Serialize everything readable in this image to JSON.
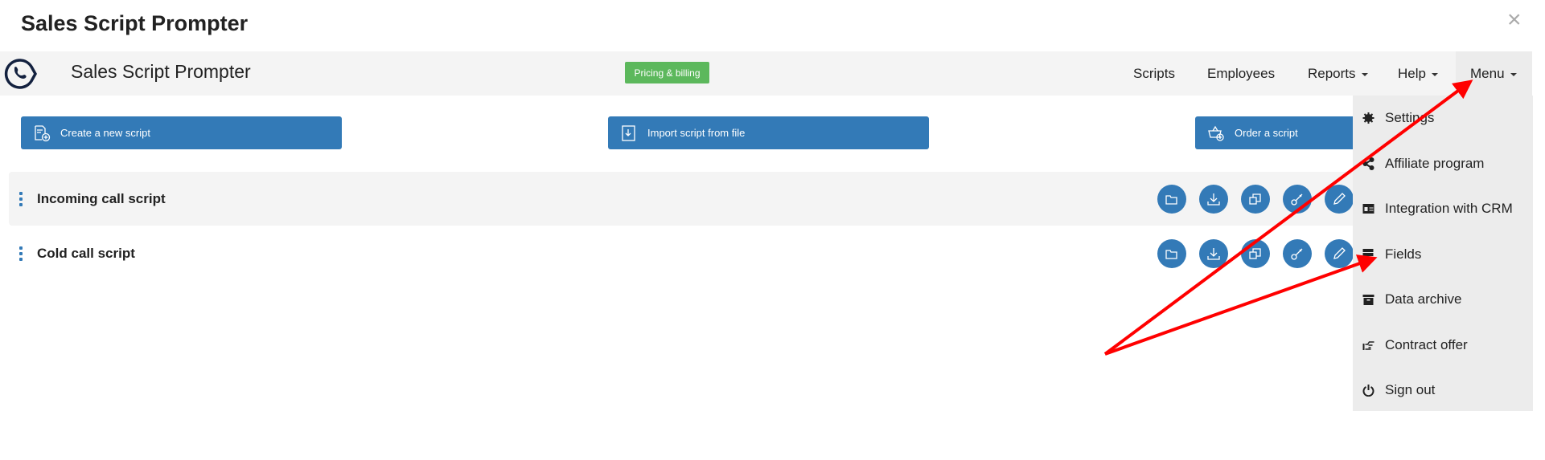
{
  "window": {
    "title": "Sales Script Prompter",
    "close_icon": "close-icon"
  },
  "header": {
    "app_name": "Sales Script Prompter",
    "badge": "Pricing & billing",
    "nav": [
      {
        "label": "Scripts"
      },
      {
        "label": "Employees"
      },
      {
        "label": "Reports"
      },
      {
        "label": "Help"
      },
      {
        "label": "Menu"
      }
    ]
  },
  "toolbar": {
    "create": "Create a new script",
    "import": "Import script from file",
    "order": "Order a script"
  },
  "scripts": [
    {
      "title": "Incoming call script"
    },
    {
      "title": "Cold call script"
    }
  ],
  "dropdown": {
    "items": [
      {
        "label": "Settings",
        "icon": "gear-icon"
      },
      {
        "label": "Affiliate program",
        "icon": "share-icon"
      },
      {
        "label": "Integration with CRM",
        "icon": "id-card-icon"
      },
      {
        "label": "Fields",
        "icon": "server-icon"
      },
      {
        "label": "Data archive",
        "icon": "archive-icon"
      },
      {
        "label": "Contract offer",
        "icon": "hand-pointing-icon"
      },
      {
        "label": "Sign out",
        "icon": "power-icon"
      }
    ]
  },
  "colors": {
    "primary": "#337ab7",
    "badge": "#5cb85c",
    "annotation": "#ff0000"
  }
}
